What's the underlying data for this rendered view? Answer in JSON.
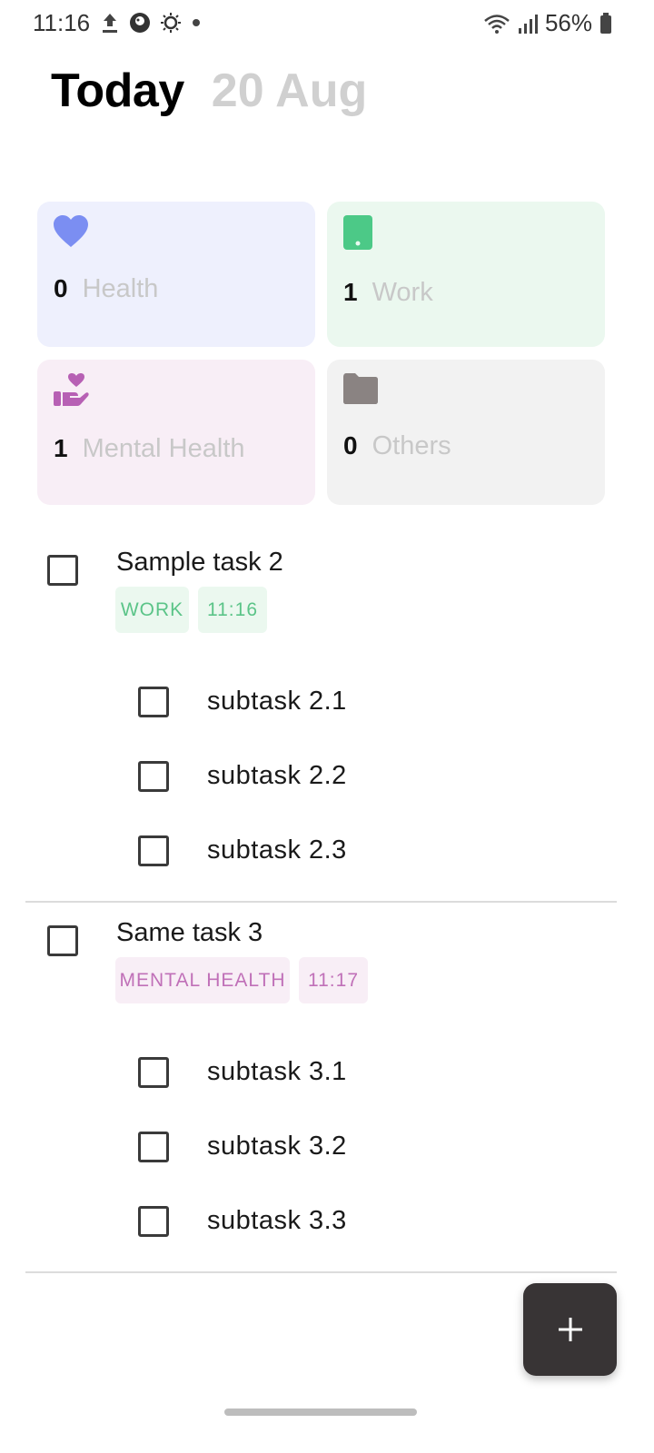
{
  "status_bar": {
    "time": "11:16",
    "battery": "56%",
    "icons": [
      "upload-icon",
      "app-icon",
      "brightness-icon",
      "dot-icon",
      "wifi-icon",
      "signal-icon",
      "battery-icon"
    ]
  },
  "header": {
    "title": "Today",
    "date": "20 Aug"
  },
  "categories": [
    {
      "name": "Health",
      "count": "0",
      "icon": "heart-icon",
      "color": "#7b8ef2",
      "bg": "#eef0fd"
    },
    {
      "name": "Work",
      "count": "1",
      "icon": "phone-icon",
      "color": "#4cc987",
      "bg": "#ebf8ef"
    },
    {
      "name": "Mental Health",
      "count": "1",
      "icon": "hand-heart-icon",
      "color": "#b760b4",
      "bg": "#f8eef6"
    },
    {
      "name": "Others",
      "count": "0",
      "icon": "folder-icon",
      "color": "#8a8382",
      "bg": "#f2f2f2"
    }
  ],
  "tasks": [
    {
      "title": "Sample task 2",
      "category_tag": "WORK",
      "time": "11:16",
      "subtasks": [
        "subtask 2.1",
        "subtask 2.2",
        "subtask 2.3"
      ]
    },
    {
      "title": "Same task 3",
      "category_tag": "MENTAL HEALTH",
      "time": "11:17",
      "subtasks": [
        "subtask 3.1",
        "subtask 3.2",
        "subtask 3.3"
      ]
    }
  ],
  "fab": {
    "icon": "plus-icon"
  }
}
